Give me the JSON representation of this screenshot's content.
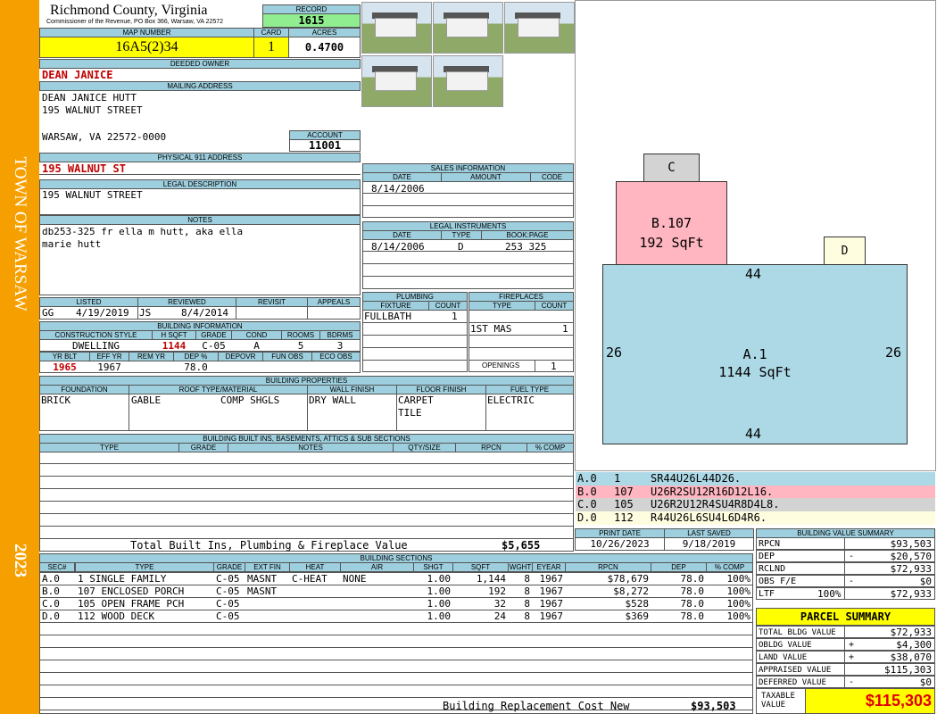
{
  "sidebar": {
    "town": "TOWN OF WARSAW",
    "year": "2023"
  },
  "header": {
    "county": "Richmond County, Virginia",
    "commissioner": "Commissioner of the Revenue, PO Box 366, Warsaw, VA 22572"
  },
  "record": {
    "label": "RECORD",
    "value": "1615"
  },
  "map_number": {
    "label": "MAP NUMBER",
    "value": "16A5(2)34"
  },
  "card": {
    "label": "CARD",
    "value": "1"
  },
  "acres": {
    "label": "ACRES",
    "value": "0.4700"
  },
  "deeded_owner": {
    "label": "DEEDED OWNER",
    "value": "DEAN JANICE"
  },
  "mailing_address": {
    "label": "MAILING ADDRESS",
    "line1": "DEAN JANICE HUTT",
    "line2": "195 WALNUT STREET",
    "line3": "WARSAW, VA 22572-0000"
  },
  "account": {
    "label": "ACCOUNT",
    "value": "11001"
  },
  "physical_address": {
    "label": "PHYSICAL 911 ADDRESS",
    "value": "195 WALNUT ST"
  },
  "legal_description": {
    "label": "LEGAL DESCRIPTION",
    "value": "195 WALNUT STREET"
  },
  "notes": {
    "label": "NOTES",
    "line1": "db253-325 fr ella m hutt, aka ella",
    "line2": "marie hutt"
  },
  "listing": {
    "listed_label": "LISTED",
    "reviewed_label": "REVIEWED",
    "revisit_label": "REVISIT",
    "appeals_label": "APPEALS",
    "listed_by": "GG",
    "listed_date": "4/19/2019",
    "reviewed_by": "JS",
    "reviewed_date": "8/4/2014"
  },
  "building_info": {
    "label": "BUILDING INFORMATION",
    "headers": [
      "CONSTRUCTION STYLE",
      "H SQFT",
      "GRADE",
      "COND",
      "ROOMS",
      "BDRMS"
    ],
    "construction_style": "DWELLING",
    "hsqft": "1144",
    "grade": "C-05",
    "cond": "A",
    "rooms": "5",
    "bdrms": "3",
    "headers2": [
      "YR BLT",
      "EFF YR",
      "REM YR",
      "DEP %",
      "DEPOVR",
      "FUN OBS",
      "ECO OBS"
    ],
    "yr_blt": "1965",
    "eff_yr": "1967",
    "dep": "78.0"
  },
  "sales": {
    "label": "SALES INFORMATION",
    "headers": [
      "DATE",
      "AMOUNT",
      "CODE"
    ],
    "date": "8/14/2006"
  },
  "legal_instruments": {
    "label": "LEGAL INSTRUMENTS",
    "headers": [
      "DATE",
      "TYPE",
      "BOOK:PAGE"
    ],
    "date": "8/14/2006",
    "type": "D",
    "bookpage": "253 325"
  },
  "plumbing": {
    "label": "PLUMBING",
    "headers": [
      "FIXTURE",
      "COUNT"
    ],
    "fixture": "FULLBATH",
    "count": "1"
  },
  "fireplaces": {
    "label": "FIREPLACES",
    "headers": [
      "TYPE",
      "COUNT"
    ],
    "type": "1ST MAS",
    "count": "1",
    "openings_label": "OPENINGS",
    "openings": "1"
  },
  "building_properties": {
    "label": "BUILDING PROPERTIES",
    "headers": [
      "FOUNDATION",
      "ROOF TYPE/MATERIAL",
      "WALL FINISH",
      "FLOOR FINISH",
      "FUEL TYPE"
    ],
    "foundation": "BRICK",
    "roof_type": "GABLE",
    "roof_material": "COMP SHGLS",
    "wall": "DRY WALL",
    "floor1": "CARPET",
    "floor2": "TILE",
    "fuel": "ELECTRIC"
  },
  "built_ins": {
    "label": "BUILDING BUILT INS, BASEMENTS, ATTICS & SUB SECTIONS",
    "headers": [
      "TYPE",
      "GRADE",
      "NOTES",
      "QTY/SIZE",
      "RPCN",
      "% COMP"
    ],
    "total_label": "Total Built Ins, Plumbing & Fireplace Value",
    "total_value": "$5,655"
  },
  "print_info": {
    "print_label": "PRINT DATE",
    "print_date": "10/26/2023",
    "saved_label": "LAST SAVED",
    "saved_date": "9/18/2019"
  },
  "building_sections": {
    "label": "BUILDING SECTIONS",
    "headers": [
      "SEC#",
      "TYPE",
      "GRADE",
      "EXT FIN",
      "HEAT",
      "AIR",
      "SHGT",
      "SQFT",
      "WGHT",
      "EYEAR",
      "RPCN",
      "DEP",
      "% COMP"
    ],
    "rows": [
      {
        "sec": "A.0",
        "type": "1 SINGLE FAMILY",
        "grade": "C-05",
        "ext": "MASNT",
        "heat": "C-HEAT",
        "air": "NONE",
        "shgt": "1.00",
        "sqft": "1,144",
        "wght": "8",
        "eyear": "1967",
        "rpcn": "$78,679",
        "dep": "78.0",
        "comp": "100%"
      },
      {
        "sec": "B.0",
        "type": "107 ENCLOSED PORCH",
        "grade": "C-05",
        "ext": "MASNT",
        "heat": "",
        "air": "",
        "shgt": "1.00",
        "sqft": "192",
        "wght": "8",
        "eyear": "1967",
        "rpcn": "$8,272",
        "dep": "78.0",
        "comp": "100%"
      },
      {
        "sec": "C.0",
        "type": "105 OPEN FRAME PCH",
        "grade": "C-05",
        "ext": "",
        "heat": "",
        "air": "",
        "shgt": "1.00",
        "sqft": "32",
        "wght": "8",
        "eyear": "1967",
        "rpcn": "$528",
        "dep": "78.0",
        "comp": "100%"
      },
      {
        "sec": "D.0",
        "type": "112 WOOD DECK",
        "grade": "C-05",
        "ext": "",
        "heat": "",
        "air": "",
        "shgt": "1.00",
        "sqft": "24",
        "wght": "8",
        "eyear": "1967",
        "rpcn": "$369",
        "dep": "78.0",
        "comp": "100%"
      }
    ],
    "replacement_label": "Building Replacement Cost New",
    "replacement_value": "$93,503"
  },
  "sketch": {
    "c_label": "C",
    "d_label": "D",
    "b_label": "B.107",
    "b_area": "192 SqFt",
    "a_label": "A.1",
    "a_area": "1144 SqFt",
    "dim_top": "44",
    "dim_bottom": "44",
    "dim_left": "26",
    "dim_right": "26",
    "legend": [
      {
        "code": "A.0",
        "num": "1",
        "path": "SR44U26L44D26.",
        "color": "#add8e6"
      },
      {
        "code": "B.0",
        "num": "107",
        "path": "U26R2SU12R16D12L16.",
        "color": "#ffb6c1"
      },
      {
        "code": "C.0",
        "num": "105",
        "path": "U26R2U12R4SU4R8D4L8.",
        "color": "#d3d3d3"
      },
      {
        "code": "D.0",
        "num": "112",
        "path": "R44U26L6SU4L6D4R6.",
        "color": "#fffde0"
      }
    ]
  },
  "building_value": {
    "label": "BUILDING VALUE SUMMARY",
    "rpcn_label": "RPCN",
    "rpcn": "$93,503",
    "dep_label": "DEP",
    "dep_sign": "-",
    "dep": "$20,570",
    "rclnd_label": "RCLND",
    "rclnd": "$72,933",
    "obs_label": "OBS F/E",
    "obs_sign": "-",
    "obs": "$0",
    "ltf_label": "LTF",
    "ltf_pct": "100%",
    "ltf": "$72,933"
  },
  "parcel_summary": {
    "label": "PARCEL SUMMARY",
    "total_bldg_label": "TOTAL BLDG VALUE",
    "total_bldg": "$72,933",
    "obldg_label": "OBLDG VALUE",
    "obldg_sign": "+",
    "obldg": "$4,300",
    "land_label": "LAND VALUE",
    "land_sign": "+",
    "land": "$38,070",
    "appraised_label": "APPRAISED VALUE",
    "appraised": "$115,303",
    "deferred_label": "DEFERRED VALUE",
    "deferred_sign": "-",
    "deferred": "$0",
    "taxable_label1": "TAXABLE",
    "taxable_label2": "VALUE",
    "taxable": "$115,303"
  }
}
